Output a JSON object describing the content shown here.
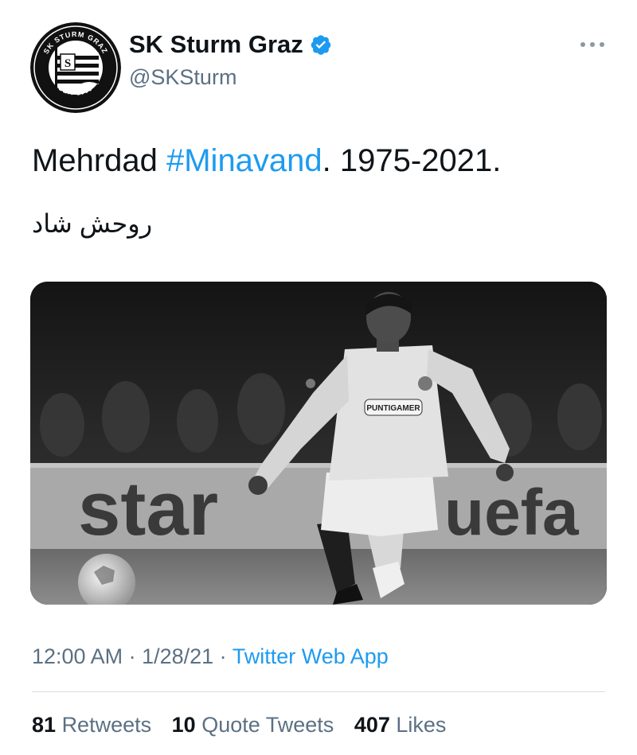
{
  "account": {
    "name": "SK Sturm Graz",
    "handle": "@SKSturm",
    "avatar_icon": "sk-sturm-graz-crest",
    "avatar_ring_top_text": "SK STURM GRAZ",
    "avatar_ring_bottom_text": "SEIT 1909",
    "verified_icon": "verified-badge-icon",
    "more_icon": "more-options-icon"
  },
  "tweet": {
    "text_before": "Mehrdad ",
    "hashtag": "#Minavand",
    "text_after": ". 1975-2021.",
    "line2": "روحش شاد"
  },
  "media": {
    "board_left_text": "star",
    "board_right_text": "uefa",
    "sponsor_text": "PUNTIGAMER"
  },
  "meta": {
    "time": "12:00 AM",
    "sep1": " · ",
    "date": "1/28/21",
    "sep2": " · ",
    "app": "Twitter Web App"
  },
  "stats": {
    "retweets_count": "81",
    "retweets_label": "Retweets",
    "quotes_count": "10",
    "quotes_label": "Quote Tweets",
    "likes_count": "407",
    "likes_label": "Likes"
  },
  "colors": {
    "link": "#1d9bf0",
    "secondary_text": "#5b7083",
    "primary_text": "#0f1419"
  }
}
